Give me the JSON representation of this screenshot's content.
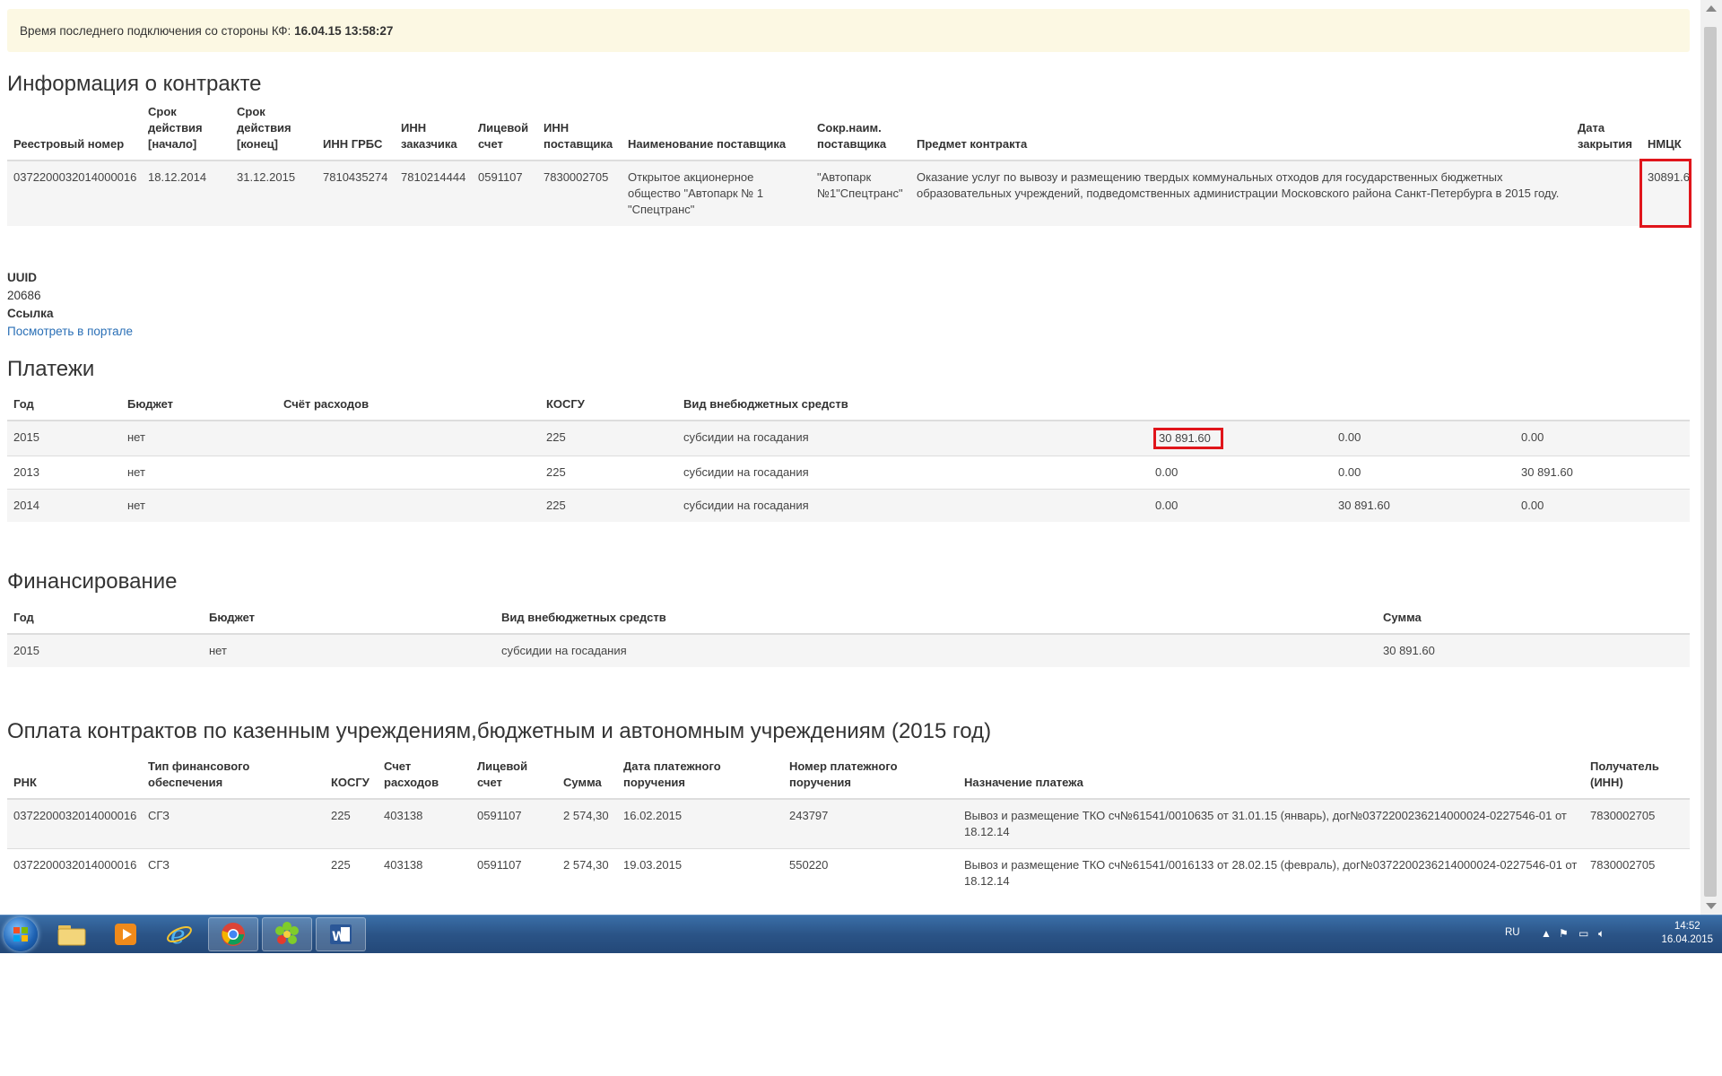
{
  "alert": {
    "text": "Время последнего подключения со стороны КФ:",
    "time": "16.04.15 13:58:27"
  },
  "contract": {
    "title": "Информация о контракте",
    "headers": [
      "Реестровый номер",
      "Срок действия [начало]",
      "Срок действия [конец]",
      "ИНН ГРБС",
      "ИНН заказчика",
      "Лицевой счет",
      "ИНН поставщика",
      "Наименование поставщика",
      "Сокр.наим. поставщика",
      "Предмет контракта",
      "Дата закрытия",
      "НМЦК"
    ],
    "row": [
      "0372200032014000016",
      "18.12.2014",
      "31.12.2015",
      "7810435274",
      "7810214444",
      "0591107",
      "7830002705",
      "Открытое акционерное общество \"Автопарк № 1 \"Спецтранс\"",
      "\"Автопарк №1\"Спецтранс\"",
      "Оказание услуг по вывозу и размещению твердых коммунальных отходов для государственных бюджетных образовательных учреждений, подведомственных администрации Московского района Санкт-Петербурга в 2015 году.",
      "",
      "30891.6"
    ]
  },
  "uuid": {
    "label": "UUID",
    "value": "20686",
    "link_label": "Ссылка",
    "link_text": "Посмотреть в портале"
  },
  "payments": {
    "title": "Платежи",
    "headers": [
      "Год",
      "Бюджет",
      "Счёт расходов",
      "КОСГУ",
      "Вид внебюджетных средств",
      "",
      "",
      ""
    ],
    "rows": [
      [
        "2015",
        "нет",
        "",
        "225",
        "субсидии на госадания",
        "30 891.60",
        "0.00",
        "0.00"
      ],
      [
        "2013",
        "нет",
        "",
        "225",
        "субсидии на госадания",
        "0.00",
        "0.00",
        "30 891.60"
      ],
      [
        "2014",
        "нет",
        "",
        "225",
        "субсидии на госадания",
        "0.00",
        "30 891.60",
        "0.00"
      ]
    ]
  },
  "financing": {
    "title": "Финансирование",
    "headers": [
      "Год",
      "Бюджет",
      "Вид внебюджетных средств",
      "Сумма"
    ],
    "rows": [
      [
        "2015",
        "нет",
        "субсидии на госадания",
        "30 891.60"
      ]
    ]
  },
  "contract_payments": {
    "title": "Оплата контрактов по казенным учреждениям,бюджетным и автономным учреждениям (2015 год)",
    "headers": [
      "РНК",
      "Тип финансового обеспечения",
      "КОСГУ",
      "Счет расходов",
      "Лицевой счет",
      "Сумма",
      "Дата платежного поручения",
      "Номер платежного поручения",
      "Назначение платежа",
      "Получатель (ИНН)"
    ],
    "rows": [
      [
        "0372200032014000016",
        "СГЗ",
        "225",
        "403138",
        "0591107",
        "2 574,30",
        "16.02.2015",
        "243797",
        "Вывоз и размещение ТКО сч№61541/0010635 от 31.01.15 (январь), дог№0372200236214000024-0227546-01 от 18.12.14",
        "7830002705"
      ],
      [
        "0372200032014000016",
        "СГЗ",
        "225",
        "403138",
        "0591107",
        "2 574,30",
        "19.03.2015",
        "550220",
        "Вывоз и размещение ТКО сч№61541/0016133 от 28.02.15 (февраль), дог№0372200236214000024-0227546-01 от 18.12.14",
        "7830002705"
      ]
    ]
  },
  "taskbar": {
    "apps": [
      "start-button",
      "explorer",
      "media-player",
      "internet-explorer",
      "chrome",
      "icq",
      "word"
    ],
    "lang": "RU",
    "time": "14:52",
    "date": "16.04.2015"
  },
  "colors": {
    "highlight": "#e0151b",
    "alert_bg": "#fcf8e3",
    "link": "#2a6fb6",
    "taskbar": "#2b5487"
  }
}
